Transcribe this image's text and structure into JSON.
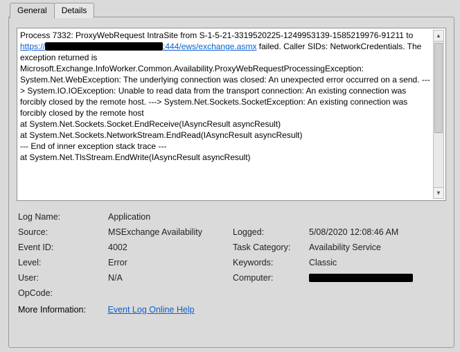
{
  "tabs": {
    "general": "General",
    "details": "Details"
  },
  "description": {
    "pre_link": "Process 7332: ProxyWebRequest IntraSite from S-1-5-21-3319520225-1249953139-1585219976-91211 to ",
    "link_prefix": "https://",
    "link_suffix": ":444/ews/exchange.asmx",
    "post_link": " failed. Caller SIDs: NetworkCredentials. The exception returned is Microsoft.Exchange.InfoWorker.Common.Availability.ProxyWebRequestProcessingException: System.Net.WebException: The underlying connection was closed: An unexpected error occurred on a send. ---> System.IO.IOException: Unable to read data from the transport connection: An existing connection was forcibly closed by the remote host. ---> System.Net.Sockets.SocketException: An existing connection was forcibly closed by the remote host",
    "stack": [
      "   at System.Net.Sockets.Socket.EndReceive(IAsyncResult asyncResult)",
      "   at System.Net.Sockets.NetworkStream.EndRead(IAsyncResult asyncResult)",
      "   --- End of inner exception stack trace ---",
      "   at System.Net.TlsStream.EndWrite(IAsyncResult asyncResult)"
    ]
  },
  "fields": {
    "log_name_label": "Log Name:",
    "log_name": "Application",
    "source_label": "Source:",
    "source": "MSExchange Availability",
    "logged_label": "Logged:",
    "logged": "5/08/2020 12:08:46 AM",
    "event_id_label": "Event ID:",
    "event_id": "4002",
    "task_category_label": "Task Category:",
    "task_category": "Availability Service",
    "level_label": "Level:",
    "level": "Error",
    "keywords_label": "Keywords:",
    "keywords": "Classic",
    "user_label": "User:",
    "user": "N/A",
    "computer_label": "Computer:",
    "opcode_label": "OpCode:",
    "opcode": "",
    "more_info_label": "More Information:",
    "more_info_link": "Event Log Online Help"
  }
}
